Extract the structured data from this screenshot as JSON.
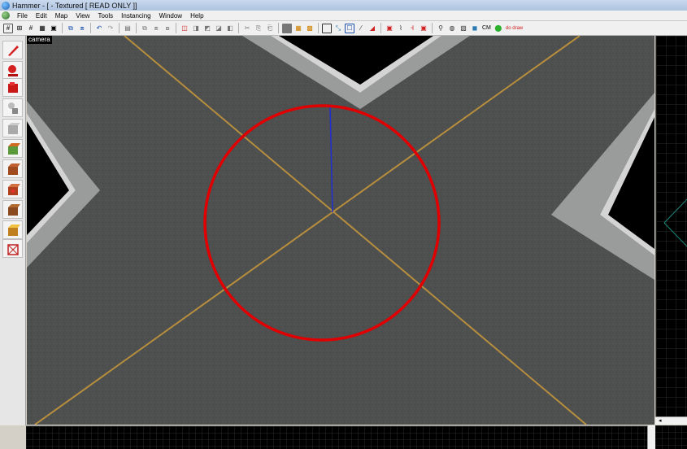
{
  "window": {
    "title": "Hammer - [ - Textured [ READ ONLY ]]"
  },
  "menu": {
    "items": [
      "File",
      "Edit",
      "Map",
      "View",
      "Tools",
      "Instancing",
      "Window",
      "Help"
    ]
  },
  "toolbar": {
    "cm_label": "CM",
    "draw_label": "do draw"
  },
  "viewport": {
    "label": "camera",
    "selection_circle_color": "#e00000",
    "road_line_color": "#c99a3a",
    "z_axis_color": "#1f2fd0"
  },
  "left_tools": [
    "selection-tool-icon",
    "magnify-tool-icon",
    "camera-tool-icon",
    "entity-tool-icon",
    "block-tool-icon",
    "texture-tool-icon",
    "apply-texture-icon",
    "decal-tool-icon",
    "overlay-tool-icon",
    "clipping-tool-icon",
    "vertex-tool-icon",
    "path-tool-icon"
  ]
}
